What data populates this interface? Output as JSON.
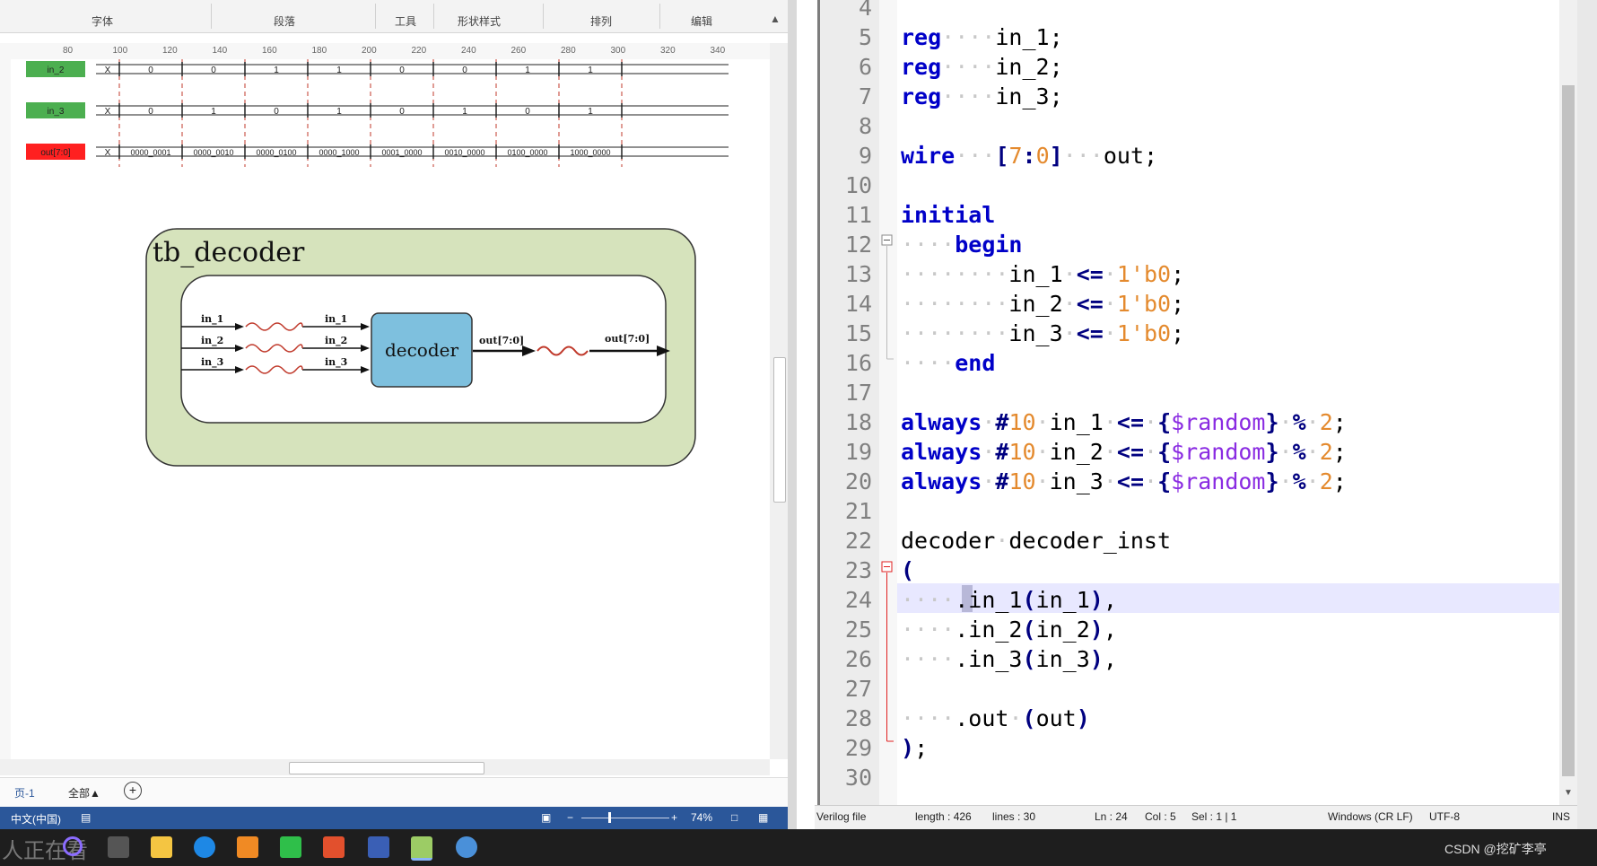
{
  "visio": {
    "ribbon_groups": [
      "字体",
      "段落",
      "工具",
      "形状样式",
      "排列",
      "编辑"
    ],
    "ruler_ticks": [
      "80",
      "100",
      "120",
      "140",
      "160",
      "180",
      "200",
      "220",
      "240",
      "260",
      "280",
      "300",
      "320",
      "340"
    ],
    "timing": {
      "signals": [
        {
          "label": "in_2",
          "color": "#4caf50",
          "values": [
            "X",
            "0",
            "0",
            "1",
            "1",
            "0",
            "0",
            "1",
            "1"
          ]
        },
        {
          "label": "in_3",
          "color": "#4caf50",
          "values": [
            "X",
            "0",
            "1",
            "0",
            "1",
            "0",
            "1",
            "0",
            "1"
          ]
        },
        {
          "label": "out[7:0]",
          "color": "#ff2020",
          "values": [
            "X",
            "0000_0001",
            "0000_0010",
            "0000_0100",
            "0000_1000",
            "0001_0000",
            "0010_0000",
            "0100_0000",
            "1000_0000"
          ]
        }
      ]
    },
    "diagram": {
      "outer_title": "tb_decoder",
      "inputs_left": [
        "in_1",
        "in_2",
        "in_3"
      ],
      "inputs_right": [
        "in_1",
        "in_2",
        "in_3"
      ],
      "block_label": "decoder",
      "out_left": "out[7:0]",
      "out_right": "out[7:0]"
    },
    "page_tabs": {
      "page": "页-1",
      "all": "全部▲",
      "add": "+"
    },
    "status": {
      "lang": "中文(中国)",
      "zoom": "74%"
    }
  },
  "editor": {
    "lines": [
      {
        "n": "4",
        "html": ""
      },
      {
        "n": "5",
        "html": "<span class='kw'>reg</span><span class='ws'>····</span>in_1;"
      },
      {
        "n": "6",
        "html": "<span class='kw'>reg</span><span class='ws'>····</span>in_2;"
      },
      {
        "n": "7",
        "html": "<span class='kw'>reg</span><span class='ws'>····</span>in_3;"
      },
      {
        "n": "8",
        "html": ""
      },
      {
        "n": "9",
        "html": "<span class='kw'>wire</span><span class='ws'>···</span><span class='op'>[</span><span class='num'>7</span><span class='op'>:</span><span class='num'>0</span><span class='op'>]</span><span class='ws'>···</span>out;"
      },
      {
        "n": "10",
        "html": ""
      },
      {
        "n": "11",
        "html": "<span class='kw'>initial</span>"
      },
      {
        "n": "12",
        "html": "<span class='ws'>····</span><span class='kw'>begin</span>"
      },
      {
        "n": "13",
        "html": "<span class='ws'>········</span>in_1<span class='ws'>·</span><span class='op'>&lt;=</span><span class='ws'>·</span><span class='num'>1'b0</span>;"
      },
      {
        "n": "14",
        "html": "<span class='ws'>········</span>in_2<span class='ws'>·</span><span class='op'>&lt;=</span><span class='ws'>·</span><span class='num'>1'b0</span>;"
      },
      {
        "n": "15",
        "html": "<span class='ws'>········</span>in_3<span class='ws'>·</span><span class='op'>&lt;=</span><span class='ws'>·</span><span class='num'>1'b0</span>;"
      },
      {
        "n": "16",
        "html": "<span class='ws'>····</span><span class='kw'>end</span>"
      },
      {
        "n": "17",
        "html": ""
      },
      {
        "n": "18",
        "html": "<span class='kw'>always</span><span class='ws'>·</span><span class='op'>#</span><span class='num'>10</span><span class='ws'>·</span>in_1<span class='ws'>·</span><span class='op'>&lt;=</span><span class='ws'>·</span><span class='op'>{</span><span class='sys'>$random</span><span class='op'>}</span><span class='ws'>·</span><span class='op'>%</span><span class='ws'>·</span><span class='num'>2</span>;"
      },
      {
        "n": "19",
        "html": "<span class='kw'>always</span><span class='ws'>·</span><span class='op'>#</span><span class='num'>10</span><span class='ws'>·</span>in_2<span class='ws'>·</span><span class='op'>&lt;=</span><span class='ws'>·</span><span class='op'>{</span><span class='sys'>$random</span><span class='op'>}</span><span class='ws'>·</span><span class='op'>%</span><span class='ws'>·</span><span class='num'>2</span>;"
      },
      {
        "n": "20",
        "html": "<span class='kw'>always</span><span class='ws'>·</span><span class='op'>#</span><span class='num'>10</span><span class='ws'>·</span>in_3<span class='ws'>·</span><span class='op'>&lt;=</span><span class='ws'>·</span><span class='op'>{</span><span class='sys'>$random</span><span class='op'>}</span><span class='ws'>·</span><span class='op'>%</span><span class='ws'>·</span><span class='num'>2</span>;"
      },
      {
        "n": "21",
        "html": ""
      },
      {
        "n": "22",
        "html": "decoder<span class='ws'>·</span>decoder_inst"
      },
      {
        "n": "23",
        "html": "<span class='op'>(</span>"
      },
      {
        "n": "24",
        "html": "<span class='ws'>····</span>.in_1<span class='op'>(</span>in_1<span class='op'>)</span>,"
      },
      {
        "n": "25",
        "html": "<span class='ws'>····</span>.in_2<span class='op'>(</span>in_2<span class='op'>)</span>,"
      },
      {
        "n": "26",
        "html": "<span class='ws'>····</span>.in_3<span class='op'>(</span>in_3<span class='op'>)</span>,"
      },
      {
        "n": "27",
        "html": ""
      },
      {
        "n": "28",
        "html": "<span class='ws'>····</span>.out<span class='ws'>·</span><span class='op'>(</span>out<span class='op'>)</span>"
      },
      {
        "n": "29",
        "html": "<span class='op'>)</span>;"
      },
      {
        "n": "30",
        "html": ""
      }
    ],
    "status": {
      "filetype": "Verilog file",
      "length": "length : 426",
      "lines": "lines : 30",
      "ln": "Ln : 24",
      "col": "Col : 5",
      "sel": "Sel : 1 | 1",
      "eol": "Windows (CR LF)",
      "encoding": "UTF-8",
      "mode": "INS"
    }
  },
  "taskbar": {
    "watermark": "人正在看",
    "tray": "CSDN @挖矿李亭"
  }
}
